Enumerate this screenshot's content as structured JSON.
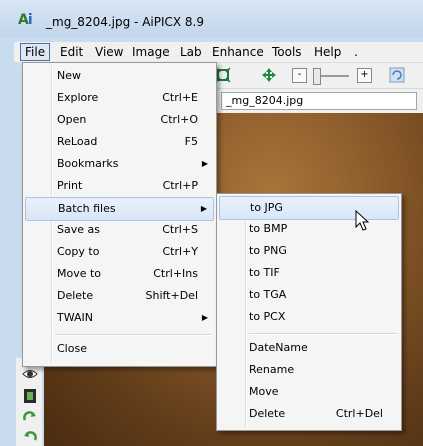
{
  "window": {
    "title": "_mg_8204.jpg - AiPICX 8.9"
  },
  "menubar": {
    "items": [
      "File",
      "Edit",
      "View",
      "Image",
      "Lab",
      "Enhance",
      "Tools",
      "Help",
      "."
    ]
  },
  "address": {
    "filename": "_mg_8204.jpg"
  },
  "file_menu": {
    "items": [
      {
        "label": "New",
        "shortcut": ""
      },
      {
        "label": "Explore",
        "shortcut": "Ctrl+E"
      },
      {
        "label": "Open",
        "shortcut": "Ctrl+O"
      },
      {
        "label": "ReLoad",
        "shortcut": "F5"
      },
      {
        "label": "Bookmarks",
        "shortcut": ""
      },
      {
        "label": "Print",
        "shortcut": "Ctrl+P"
      },
      {
        "label": "Batch files",
        "shortcut": ""
      },
      {
        "label": "Save as",
        "shortcut": "Ctrl+S"
      },
      {
        "label": "Copy to",
        "shortcut": "Ctrl+Y"
      },
      {
        "label": "Move to",
        "shortcut": "Ctrl+Ins"
      },
      {
        "label": "Delete",
        "shortcut": "Shift+Del"
      },
      {
        "label": "TWAIN",
        "shortcut": ""
      },
      {
        "label": "Close",
        "shortcut": ""
      }
    ]
  },
  "batch_menu": {
    "items": [
      {
        "label": "to JPG",
        "shortcut": ""
      },
      {
        "label": "to BMP",
        "shortcut": ""
      },
      {
        "label": "to PNG",
        "shortcut": ""
      },
      {
        "label": "to TIF",
        "shortcut": ""
      },
      {
        "label": "to TGA",
        "shortcut": ""
      },
      {
        "label": "to PCX",
        "shortcut": ""
      },
      {
        "label": "DateName",
        "shortcut": ""
      },
      {
        "label": "Rename",
        "shortcut": ""
      },
      {
        "label": "Move",
        "shortcut": ""
      },
      {
        "label": "Delete",
        "shortcut": "Ctrl+Del"
      }
    ]
  },
  "colors": {
    "highlight": "#d9e6f7",
    "image_brown": "#8a5a2a"
  },
  "icons": [
    "app-logo-icon",
    "zoom-fit-icon",
    "move-icon",
    "zoom-minus-icon",
    "zoom-plus-icon",
    "refresh-icon",
    "eye-icon",
    "filmstrip-icon",
    "rotate-right-icon",
    "rotate-left-icon",
    "arrow-cursor-icon"
  ]
}
